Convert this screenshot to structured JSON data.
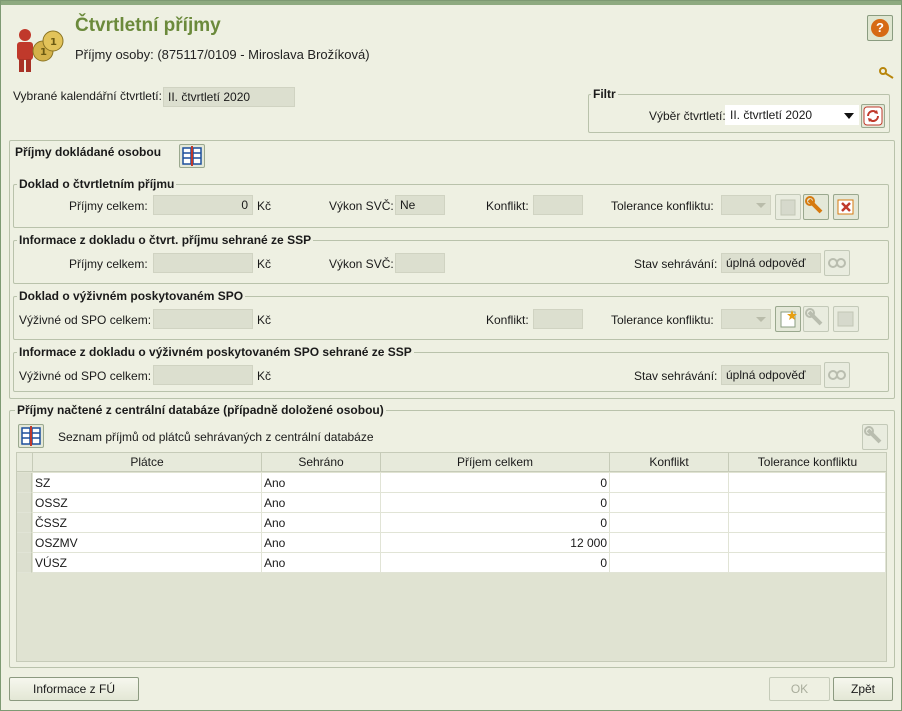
{
  "header": {
    "title": "Čtvrtletní příjmy",
    "subtitle": "Příjmy osoby: (875117/0109 - Miroslava Brožíková)"
  },
  "selection": {
    "label": "Vybrané kalendářní čtvrtletí:",
    "value": "II. čtvrtletí 2020"
  },
  "filter": {
    "legend": "Filtr",
    "quarter_label": "Výběr čtvrtletí:",
    "quarter_value": "II. čtvrtletí 2020"
  },
  "documented": {
    "title": "Příjmy dokládané osobou",
    "quarterly_doc": {
      "legend": "Doklad o čtvrtletním příjmu",
      "income_label": "Příjmy celkem:",
      "income_value": "0",
      "currency": "Kč",
      "svc_label": "Výkon SVČ:",
      "svc_value": "Ne",
      "conflict_label": "Konflikt:",
      "conflict_value": "",
      "tolerance_label": "Tolerance konfliktu:"
    },
    "quarterly_ssp": {
      "legend": "Informace z dokladu o čtvrt. příjmu sehrané ze SSP",
      "income_label": "Příjmy celkem:",
      "income_value": "",
      "currency": "Kč",
      "svc_label": "Výkon SVČ:",
      "svc_value": "",
      "match_label": "Stav sehrávání:",
      "match_value": "úplná odpověď"
    },
    "alimony_doc": {
      "legend": "Doklad o výživném poskytovaném SPO",
      "alimony_label": "Výživné od SPO celkem:",
      "alimony_value": "",
      "currency": "Kč",
      "conflict_label": "Konflikt:",
      "conflict_value": "",
      "tolerance_label": "Tolerance konfliktu:"
    },
    "alimony_ssp": {
      "legend": "Informace z dokladu o výživném poskytovaném SPO sehrané ze SSP",
      "alimony_label": "Výživné od SPO celkem:",
      "alimony_value": "",
      "currency": "Kč",
      "match_label": "Stav sehrávání:",
      "match_value": "úplná odpověď"
    }
  },
  "central": {
    "legend": "Příjmy načtené z centrální databáze (případně doložené osobou)",
    "list_title": "Seznam příjmů od plátců sehrávaných z centrální databáze",
    "columns": [
      "Plátce",
      "Sehráno",
      "Příjem celkem",
      "Konflikt",
      "Tolerance konfliktu"
    ],
    "rows": [
      [
        "SZ",
        "Ano",
        "0",
        "",
        ""
      ],
      [
        "OSSZ",
        "Ano",
        "0",
        "",
        ""
      ],
      [
        "ČSSZ",
        "Ano",
        "0",
        "",
        ""
      ],
      [
        "OSZMV",
        "Ano",
        "12 000",
        "",
        ""
      ],
      [
        "VÚSZ",
        "Ano",
        "0",
        "",
        ""
      ]
    ]
  },
  "footer": {
    "info_button": "Informace z FÚ",
    "ok_button": "OK",
    "back_button": "Zpět"
  }
}
